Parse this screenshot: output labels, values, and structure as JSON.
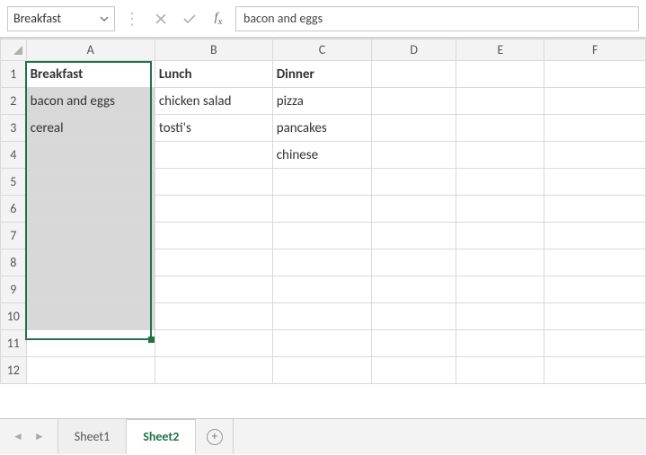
{
  "formula_bar": {
    "name_box": "Breakfast",
    "formula_value": "bacon and eggs"
  },
  "columns": [
    "A",
    "B",
    "C",
    "D",
    "E",
    "F"
  ],
  "rows": [
    "1",
    "2",
    "3",
    "4",
    "5",
    "6",
    "7",
    "8",
    "9",
    "10",
    "11",
    "12"
  ],
  "cells": {
    "A1": "Breakfast",
    "B1": "Lunch",
    "C1": "Dinner",
    "A2": "bacon and eggs",
    "B2": "chicken salad",
    "C2": "pizza",
    "A3": "cereal",
    "B3": "tosti's",
    "C3": "pancakes",
    "C4": "chinese"
  },
  "sheet_tabs": {
    "tab1": "Sheet1",
    "tab2": "Sheet2"
  },
  "chart_data": {
    "type": "table",
    "title": "",
    "columns": [
      "Breakfast",
      "Lunch",
      "Dinner"
    ],
    "rows": [
      [
        "bacon and eggs",
        "chicken salad",
        "pizza"
      ],
      [
        "cereal",
        "tosti's",
        "pancakes"
      ],
      [
        "",
        "",
        "chinese"
      ]
    ]
  }
}
